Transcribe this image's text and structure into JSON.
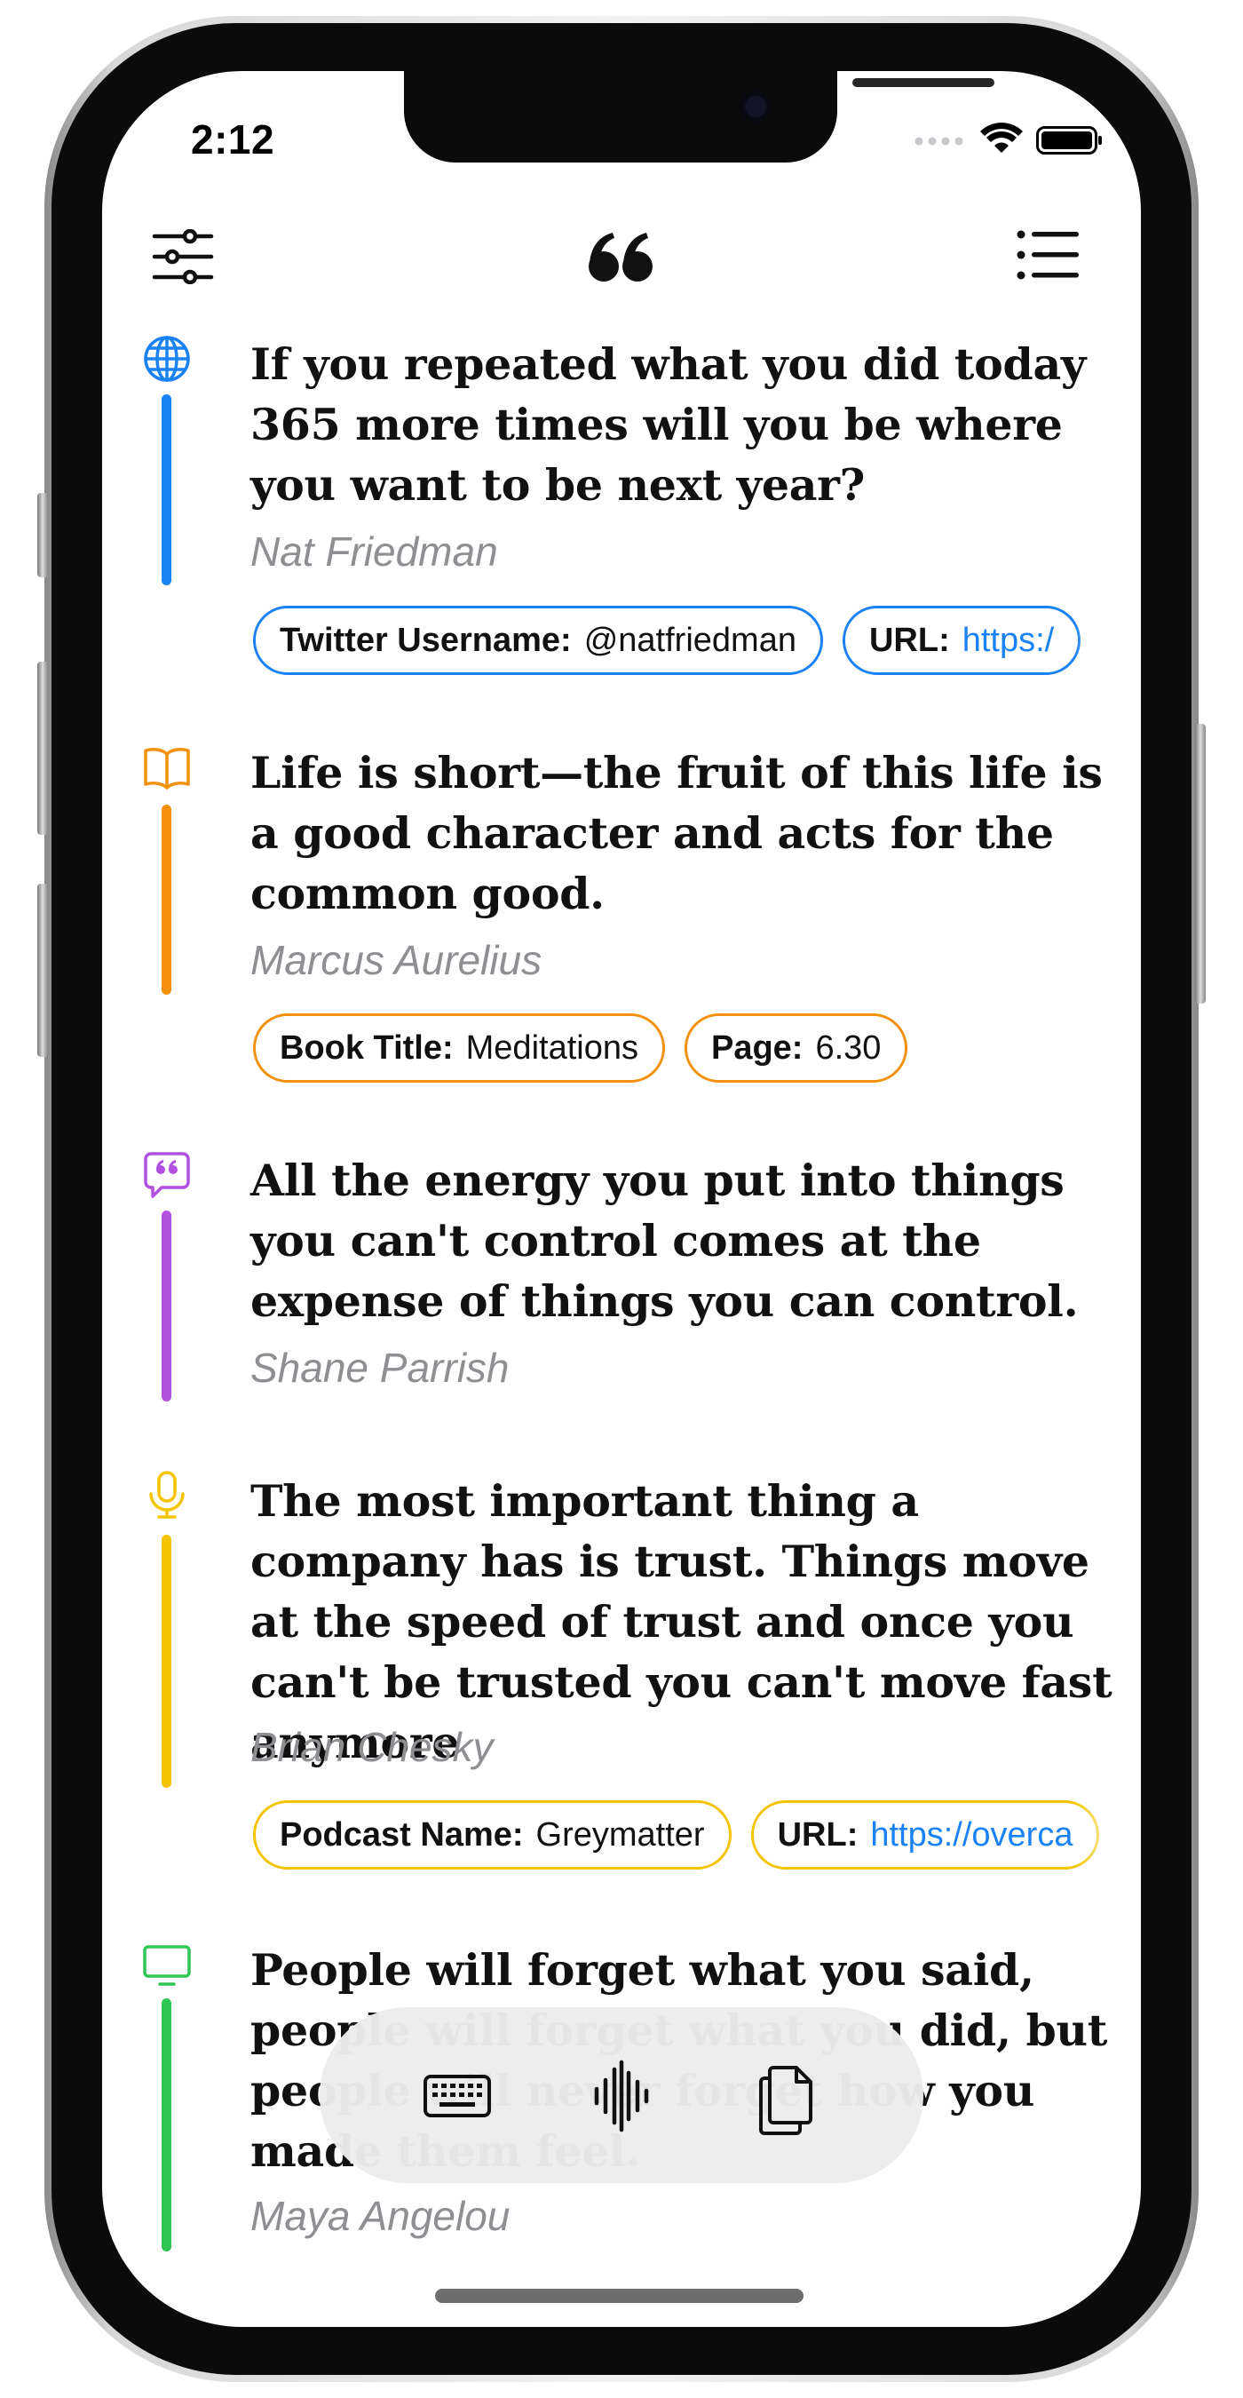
{
  "status_bar": {
    "time": "2:12"
  },
  "toolbar": {
    "filter_icon": "sliders-icon",
    "logo_icon": "quote-mark-icon",
    "list_icon": "list-icon"
  },
  "entries": [
    {
      "source_icon": "globe-icon",
      "color": "#1a82f7",
      "text": "If you repeated what you did today 365 more times will you be where you want to be next year?",
      "author": "Nat Friedman",
      "chips": [
        {
          "label": "Twitter Username:",
          "value": "@natfriedman"
        },
        {
          "label": "URL:",
          "value": "https:/"
        }
      ]
    },
    {
      "source_icon": "book-icon",
      "color": "#f5900d",
      "text": "Life is short—the fruit of this life is a good character and acts for the common good.",
      "author": "Marcus Aurelius",
      "chips": [
        {
          "label": "Book Title:",
          "value": "Meditations"
        },
        {
          "label": "Page:",
          "value": "6.30"
        }
      ]
    },
    {
      "source_icon": "quote-bubble-icon",
      "color": "#b251e0",
      "text": "All the energy you put into things you can't control comes at the expense of things you can control.",
      "author": "Shane Parrish",
      "chips": []
    },
    {
      "source_icon": "microphone-icon",
      "color": "#f5c400",
      "text": "The most important thing a company has is trust. Things move at the speed of trust and once you can't be trusted you can't move fast anymore",
      "author": "Brian Chesky",
      "chips": [
        {
          "label": "Podcast Name:",
          "value": "Greymatter"
        },
        {
          "label": "URL:",
          "value": "https://overca"
        }
      ]
    },
    {
      "source_icon": "tv-icon",
      "color": "#2fc653",
      "text": "People will forget what you said, people will forget what you did, but people will never forget how you made them feel.",
      "author": "Maya Angelou",
      "chips": []
    }
  ],
  "floating_actions": {
    "keyboard_icon": "keyboard-icon",
    "audio_icon": "waveform-icon",
    "paste_icon": "clipboard-icon"
  }
}
